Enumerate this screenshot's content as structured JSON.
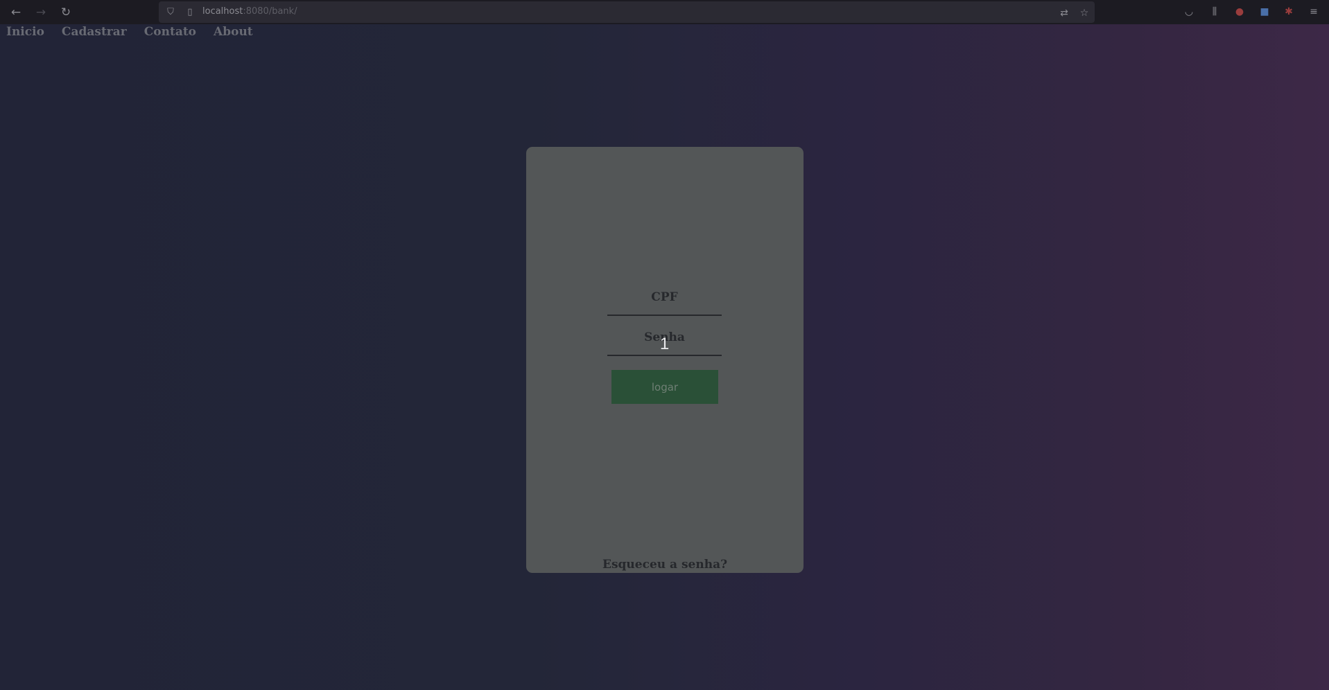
{
  "browser": {
    "url_host": "localhost",
    "url_rest": ":8080/bank/",
    "icons": [
      "back-icon",
      "forward-icon",
      "reload-icon",
      "shield-icon",
      "page-icon",
      "translate-icon",
      "bookmark-star-icon",
      "pocket-icon",
      "library-icon",
      "extension-icon",
      "extension-icon",
      "extension-icon",
      "menu-icon"
    ]
  },
  "nav": {
    "items": [
      {
        "label": "Inicio"
      },
      {
        "label": "Cadastrar"
      },
      {
        "label": "Contato"
      },
      {
        "label": "About"
      }
    ]
  },
  "login": {
    "cpf_label": "CPF",
    "senha_label": "Senha",
    "senha_value": "1",
    "button_label": "logar",
    "forgot_label": "Esqueceu a senha?"
  },
  "colors": {
    "card": "#535657",
    "button": "#2a5037",
    "background_start": "#222437",
    "background_end": "#3d2847"
  }
}
